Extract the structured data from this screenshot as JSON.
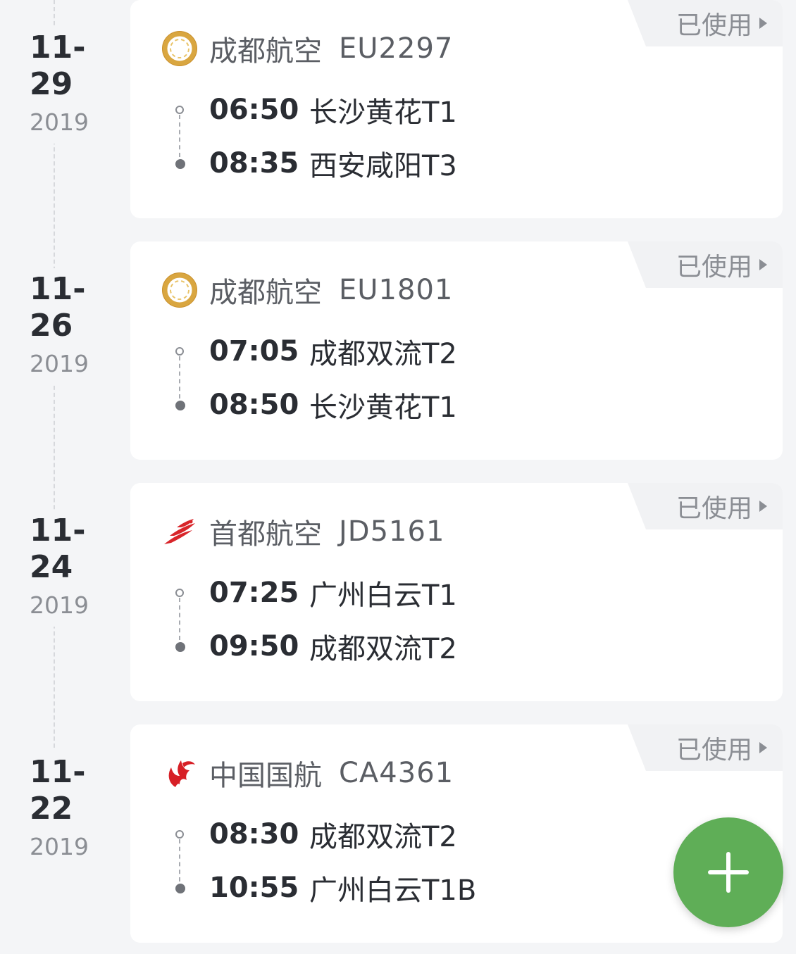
{
  "trips": [
    {
      "date": "11-29",
      "year": "2019",
      "status": "已使用",
      "airline": "成都航空",
      "flight_no": "EU2297",
      "logo": "chengdu-airlines-logo",
      "dep_time": "06:50",
      "dep_airport": "长沙黄花T1",
      "arr_time": "08:35",
      "arr_airport": "西安咸阳T3"
    },
    {
      "date": "11-26",
      "year": "2019",
      "status": "已使用",
      "airline": "成都航空",
      "flight_no": "EU1801",
      "logo": "chengdu-airlines-logo",
      "dep_time": "07:05",
      "dep_airport": "成都双流T2",
      "arr_time": "08:50",
      "arr_airport": "长沙黄花T1"
    },
    {
      "date": "11-24",
      "year": "2019",
      "status": "已使用",
      "airline": "首都航空",
      "flight_no": "JD5161",
      "logo": "capital-airlines-logo",
      "dep_time": "07:25",
      "dep_airport": "广州白云T1",
      "arr_time": "09:50",
      "arr_airport": "成都双流T2"
    },
    {
      "date": "11-22",
      "year": "2019",
      "status": "已使用",
      "airline": "中国国航",
      "flight_no": "CA4361",
      "logo": "air-china-logo",
      "dep_time": "08:30",
      "dep_airport": "成都双流T2",
      "arr_time": "10:55",
      "arr_airport": "广州白云T1B"
    }
  ],
  "fab": {
    "icon": "plus-icon"
  },
  "colors": {
    "background": "#f4f5f7",
    "fab": "#5fae57",
    "chengdu_logo": "#d9a640",
    "capital_logo": "#d8252a",
    "airchina_logo": "#d71f26"
  }
}
